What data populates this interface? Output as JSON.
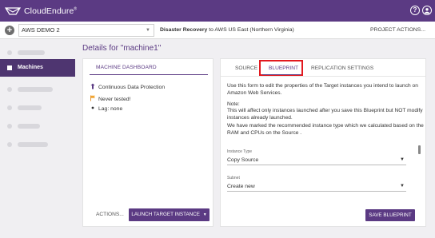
{
  "app": {
    "name": "CloudEndure",
    "trademark": "®"
  },
  "topbar": {
    "help_icon": "question-circle-icon",
    "user_icon": "user-circle-icon"
  },
  "subheader": {
    "project": "AWS DEMO 2",
    "dr_label": "Disaster Recovery",
    "dr_rest": " to AWS US East (Northern Virginia)",
    "project_actions": "PROJECT ACTIONS..."
  },
  "sidebar": {
    "active_item": "Machines"
  },
  "details": {
    "title": "Details for \"machine1\""
  },
  "machine_dashboard": {
    "tab_label": "MACHINE DASHBOARD",
    "statuses": [
      {
        "icon": "sync-icon",
        "text": "Continuous Data Protection"
      },
      {
        "icon": "flag-icon",
        "text": "Never tested!"
      },
      {
        "icon": "dot-icon",
        "text": "Lag: none"
      }
    ],
    "actions_label": "ACTIONS...",
    "launch_label": "LAUNCH TARGET INSTANCE"
  },
  "blueprint_panel": {
    "tabs": [
      "SOURCE",
      "BLUEPRINT",
      "REPLICATION SETTINGS"
    ],
    "active_tab": "BLUEPRINT",
    "intro": "Use this form to edit the properties of the Target instances you intend to launch on Amazon Web Services.",
    "note_title": "Note:",
    "note_body": "This will affect only instances launched after you save this Blueprint but NOT modify instances already launched.",
    "recommend": "We have marked the recommended instance type which we calculated based on the RAM and CPUs on the Source .",
    "instance_type_label": "Instance Type",
    "instance_type_value": "Copy Source",
    "subnet_label": "Subnet",
    "subnet_value": "Create new",
    "save_label": "SAVE BLUEPRINT"
  },
  "colors": {
    "brand": "#5b3a83",
    "highlight": "#e2191f"
  }
}
